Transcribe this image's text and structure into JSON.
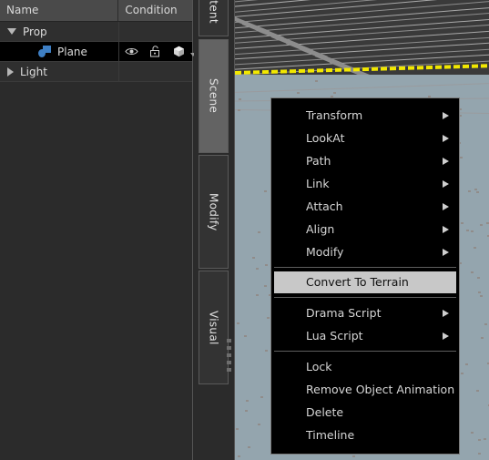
{
  "outliner": {
    "columns": [
      "Name",
      "Condition"
    ],
    "rows": [
      {
        "label": "Prop",
        "level": 0,
        "expander": "triangle-down-icon",
        "selected": false,
        "icon": null,
        "condition_icons": []
      },
      {
        "label": "Plane",
        "level": 1,
        "expander": null,
        "selected": true,
        "icon": "plane-object-icon",
        "condition_icons": [
          "visibility-eye-icon",
          "unlocked-padlock-icon",
          "cube-icon",
          "dropdown-caret-icon"
        ]
      },
      {
        "label": "Light",
        "level": 0,
        "expander": "triangle-right-icon",
        "selected": false,
        "icon": null,
        "condition_icons": []
      }
    ]
  },
  "tabs": [
    {
      "label": "Content",
      "active": false
    },
    {
      "label": "Scene",
      "active": true
    },
    {
      "label": "Modify",
      "active": false
    },
    {
      "label": "Visual",
      "active": false
    }
  ],
  "context_menu": {
    "items": [
      {
        "label": "Transform",
        "submenu": true,
        "highlight": false
      },
      {
        "label": "LookAt",
        "submenu": true,
        "highlight": false
      },
      {
        "label": "Path",
        "submenu": true,
        "highlight": false
      },
      {
        "label": "Link",
        "submenu": true,
        "highlight": false
      },
      {
        "label": "Attach",
        "submenu": true,
        "highlight": false
      },
      {
        "label": "Align",
        "submenu": true,
        "highlight": false
      },
      {
        "label": "Modify",
        "submenu": true,
        "highlight": false
      },
      {
        "separator": true
      },
      {
        "label": "Convert To Terrain",
        "submenu": false,
        "highlight": true
      },
      {
        "separator": true
      },
      {
        "label": "Drama Script",
        "submenu": true,
        "highlight": false
      },
      {
        "label": "Lua Script",
        "submenu": true,
        "highlight": false
      },
      {
        "separator": true
      },
      {
        "label": "Lock",
        "submenu": false,
        "highlight": false
      },
      {
        "label": "Remove Object Animation",
        "submenu": false,
        "highlight": false
      },
      {
        "label": "Delete",
        "submenu": false,
        "highlight": false
      },
      {
        "label": "Timeline",
        "submenu": false,
        "highlight": false
      }
    ]
  },
  "viewport": {
    "sky_color": "#3a3a3a",
    "ground_color": "#94a5ae",
    "selection_outline_color": "#f2e800",
    "grid_line_color": "#a9a9a9"
  },
  "theme": {
    "panel_bg": "#2b2b2b",
    "header_bg": "#4a4a4a",
    "row_bg": "#2f2f2f",
    "selected_row_bg": "#000000",
    "text": "#dcdcdc",
    "menu_bg": "#000000",
    "menu_highlight": "#c8c8c8",
    "accent_blue": "#3e7fc4"
  }
}
